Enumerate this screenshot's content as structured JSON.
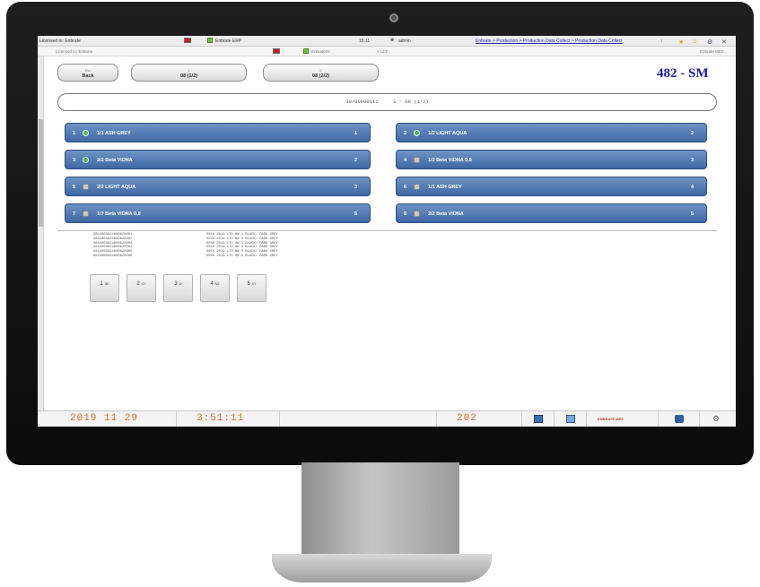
{
  "topbar": {
    "licensed": "Licensed to: Enbrate",
    "erp_label": "Enbrate ERP",
    "time": "15:11",
    "user": "admin",
    "breadcrumb": "Enbrate > Production > Production Data Collect > Production Data Collect"
  },
  "subbar": {
    "left": "Licensed to: Enbrate",
    "middle": "EnbrateDc",
    "version": "v 12.0",
    "right": "Enbrate MES"
  },
  "nav": {
    "back_top": "Esc",
    "back_label": "Back",
    "tab1_top": "1",
    "tab1_label": "08 (1/2)",
    "tab2_top": "2",
    "tab2_label": "08 (2/2)"
  },
  "station_label": "482 - SM",
  "info": {
    "order": "30/00000111",
    "detail": "1 - 08   (1/2)"
  },
  "items": [
    {
      "num": "1",
      "status": "ok",
      "name": "1/1 ASH GREY",
      "qty": "1"
    },
    {
      "num": "2",
      "status": "ok",
      "name": "1/2 LIGHT AQUA",
      "qty": "2"
    },
    {
      "num": "3",
      "status": "ok",
      "name": "2/2 Beta VIDNA",
      "qty": "2"
    },
    {
      "num": "4",
      "status": "pending",
      "name": "1/2 Beta VIDNA 0,8",
      "qty": "3"
    },
    {
      "num": "5",
      "status": "pending",
      "name": "2/2 LIGHT AQUA",
      "qty": "3"
    },
    {
      "num": "6",
      "status": "pending",
      "name": "1/1 ASH GREY",
      "qty": "4"
    },
    {
      "num": "7",
      "status": "pending",
      "name": "1/7 Beta VIDNA 0,8",
      "qty": "5"
    },
    {
      "num": "8",
      "status": "pending",
      "name": "2/2 Beta VIDNA",
      "qty": "5"
    }
  ],
  "records": {
    "serials": [
      "9844003824600620001",
      "9844003824600620002",
      "9844003824600620003",
      "9844003824600620004",
      "9844003824600620005",
      "9844003824600620006"
    ],
    "details": [
      "0010  2019 LTO HW 1 BLACK/ DARK GREY",
      "0020  2019 LTO HW 2 BLACK/ DARK GREY",
      "0030  2019 LTO HW 3 BLACK/ DARK GREY",
      "0040  2019 LTO HW 4 BLACK/ DARK GREY",
      "0050  2019 LTO HW 5 BLACK/ DARK GREY",
      "0060  2019 LTO HW 6 BLACK/ DARK GREY"
    ]
  },
  "sizes": [
    {
      "num": "1",
      "code": "NE"
    },
    {
      "num": "2",
      "code": "OX"
    },
    {
      "num": "3",
      "code": "W"
    },
    {
      "num": "4",
      "code": "NS"
    },
    {
      "num": "5",
      "code": "SY"
    }
  ],
  "status": {
    "date": "2019 11 29",
    "time": "3:51:11",
    "count": "202",
    "brand": "ENBRATE MES"
  },
  "colors": {
    "item_button": "#4a72ad",
    "station_label": "#1c1c9e",
    "lcd_digits": "#e0662a"
  }
}
